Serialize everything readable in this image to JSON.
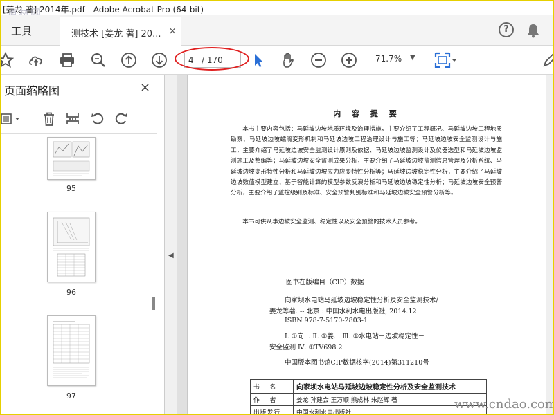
{
  "window": {
    "title": "[姜龙 著] 2014年.pdf - Adobe Acrobat Pro (64-bit)"
  },
  "watermark_top_left": "道林网",
  "watermark_bottom_right": "www.cndao.com",
  "tabs": {
    "tools_label": "工具",
    "doc_tab_label": "测技术 [姜龙 著] 20...",
    "doc_tab_close": "×"
  },
  "header_icons": [
    "help-icon",
    "bell-icon"
  ],
  "toolbar": {
    "icons": [
      "star-icon",
      "upload-icon",
      "print-icon",
      "zoom-search-icon",
      "page-up-icon",
      "page-down-icon",
      "select-arrow-icon",
      "hand-icon",
      "zoom-out-icon",
      "zoom-in-icon",
      "fit-page-icon"
    ],
    "page_current": "4",
    "page_total": "/ 170",
    "zoom": "71.7%",
    "zoom_arrow": "▼"
  },
  "left_panel": {
    "title": "页面缩略图",
    "close": "×",
    "tool_icons": [
      "options-icon",
      "trash-icon",
      "insert-icon",
      "rotate-ccw-icon",
      "rotate-cw-icon"
    ],
    "thumbnails": [
      {
        "page": "95"
      },
      {
        "page": "96"
      },
      {
        "page": "97"
      }
    ]
  },
  "collapse_arrow": "◀",
  "document": {
    "summary_title": "内 容 提 要",
    "summary_para1": "本书主要内容包括：马延坡边坡地质环境及治理措施，主要介绍了工程概况、马延坡边坡工程地质勘察、马延坡边坡蠕滑变形机制和马延坡边坡工程治理设计与施工等；马延坡边坡安全监测设计与施工，主要介绍了马延坡边坡安全监测设计原则及依据、马延坡边坡监测设计及仪器选型和马延坡边坡监测施工及整编等；马延坡边坡安全监测成果分析，主要介绍了马延坡边坡监测信息管理及分析系统、马延坡边坡变形特性分析和马延坡边坡应力应变特性分析等；马延坡边坡稳定性分析，主要介绍了马延坡边坡数值模型建立、基于智能计算的模型参数反演分析和马延坡边坡稳定性分析；马延坡边坡安全预警分析，主要介绍了监控级别及标准、安全预警判别标准和马延坡边坡安全预警分析等。",
    "summary_para2": "本书可供从事边坡安全监测、稳定性以及安全预警的技术人员参考。",
    "cip_title": "图书在版编目（CIP）数据",
    "cip_line1": "向家坝水电站马延坡边坡稳定性分析及安全监测技术/",
    "cip_line2": "姜龙等著. -- 北京 : 中国水利水电出版社, 2014.12",
    "cip_line3": "ISBN 978-7-5170-2803-1",
    "cip_line4": "Ⅰ. ①向… Ⅱ. ①姜… Ⅲ. ①水电站－边坡稳定性－",
    "cip_line5": "安全监测 Ⅳ. ①TV698.2",
    "cip_line6": "中国版本图书馆CIP数据核字(2014)第311210号",
    "info_rows": [
      {
        "key": "书 名",
        "value": "向家坝水电站马延坡边坡稳定性分析及安全监测技术"
      },
      {
        "key": "作 者",
        "value": "姜龙 孙建会 王万顺 熊成林 朱赵辉 著"
      },
      {
        "key": "出版发行",
        "value": "中国水利水电出版社"
      }
    ]
  }
}
